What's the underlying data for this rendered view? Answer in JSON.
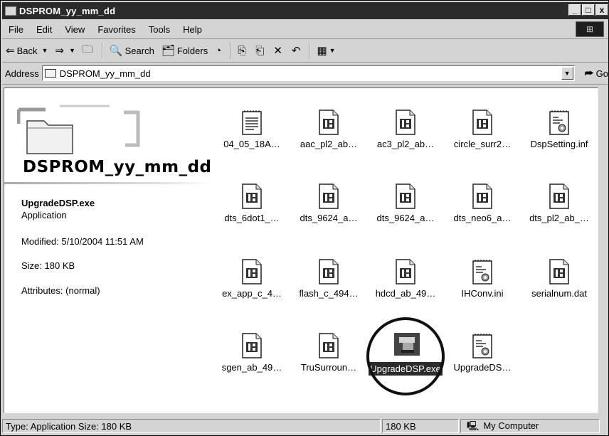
{
  "window": {
    "title": "DSPROM_yy_mm_dd",
    "buttons": [
      "_",
      "□",
      "x"
    ]
  },
  "menu": [
    {
      "label": "File",
      "key": "F"
    },
    {
      "label": "Edit",
      "key": "E"
    },
    {
      "label": "View",
      "key": "V"
    },
    {
      "label": "Favorites",
      "key": "a"
    },
    {
      "label": "Tools",
      "key": "T"
    },
    {
      "label": "Help",
      "key": "H"
    }
  ],
  "toolbar": {
    "back": "Back",
    "search": "Search",
    "folders": "Folders"
  },
  "address": {
    "label": "Address",
    "value": "DSPROM_yy_mm_dd",
    "go": "Go"
  },
  "leftpane": {
    "folder_name": "DSPROM_yy_mm_dd",
    "selected_name": "UpgradeDSP.exe",
    "selected_type": "Application",
    "modified": "Modified: 5/10/2004 11:51 AM",
    "size": "Size: 180 KB",
    "attributes": "Attributes: (normal)"
  },
  "files": [
    {
      "label": "04_05_18A…",
      "icon": "text-document-icon"
    },
    {
      "label": "aac_pl2_ab…",
      "icon": "binary-file-icon"
    },
    {
      "label": "ac3_pl2_ab…",
      "icon": "binary-file-icon"
    },
    {
      "label": "circle_surr2…",
      "icon": "binary-file-icon"
    },
    {
      "label": "DspSetting.inf",
      "icon": "settings-file-icon"
    },
    {
      "label": "dts_6dot1_…",
      "icon": "binary-file-icon"
    },
    {
      "label": "dts_9624_a…",
      "icon": "binary-file-icon"
    },
    {
      "label": "dts_9624_a…",
      "icon": "binary-file-icon"
    },
    {
      "label": "dts_neo6_a…",
      "icon": "binary-file-icon"
    },
    {
      "label": "dts_pl2_ab_…",
      "icon": "binary-file-icon"
    },
    {
      "label": "ex_app_c_4…",
      "icon": "binary-file-icon"
    },
    {
      "label": "flash_c_494…",
      "icon": "binary-file-icon"
    },
    {
      "label": "hdcd_ab_49…",
      "icon": "binary-file-icon"
    },
    {
      "label": "IHConv.ini",
      "icon": "settings-file-icon"
    },
    {
      "label": "serialnum.dat",
      "icon": "binary-file-icon"
    },
    {
      "label": "sgen_ab_49…",
      "icon": "binary-file-icon"
    },
    {
      "label": "TruSurroun…",
      "icon": "binary-file-icon"
    },
    {
      "label": "UpgradeDSP.exe",
      "icon": "application-icon",
      "selected": true
    },
    {
      "label": "UpgradeDS…",
      "icon": "settings-file-icon"
    }
  ],
  "status": {
    "text": "Type: Application Size: 180 KB",
    "size": "180 KB",
    "zone": "My Computer"
  }
}
